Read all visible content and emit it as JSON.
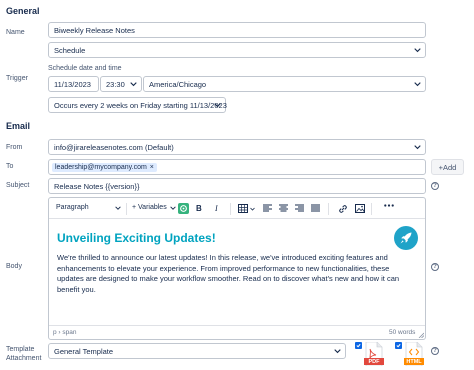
{
  "sections": {
    "general": "General",
    "email": "Email"
  },
  "labels": {
    "name": "Name",
    "trigger": "Trigger",
    "schedule_date_time": "Schedule date and time",
    "from": "From",
    "to": "To",
    "subject": "Subject",
    "body": "Body",
    "template_attachment": "Template Attachment"
  },
  "fields": {
    "name": "Biweekly Release Notes",
    "trigger_type": "Schedule",
    "date": "11/13/2023",
    "time": "23:30",
    "timezone": "America/Chicago",
    "recurrence": "Occurs every 2 weeks on Friday starting 11/13/2023",
    "from": "info@jirareleasenotes.com (Default)",
    "to_tag": "leadership@mycompany.com",
    "to_tag_remove": "×",
    "add_button": "+Add",
    "subject": "Release Notes {{version}}",
    "template": "General Template"
  },
  "toolbar": {
    "paragraph": "Paragraph",
    "variables": "+ Variables",
    "bold": "B",
    "italic": "I"
  },
  "editor": {
    "heading": "Unveiling Exciting Updates!",
    "paragraph": "We're thrilled to announce our latest updates! In this release, we've introduced exciting features and enhancements to elevate your experience. From improved performance to new functionalities, these updates are designed to make your workflow smoother. Read on to discover what's new and how it can benefit you.",
    "path": "p › span",
    "word_count": "50 words"
  },
  "attachments": {
    "pdf_label": "PDF",
    "html_label": "HTML"
  },
  "colors": {
    "accent": "#0c66e4",
    "heading": "#00a3bf",
    "pdf": "#e2483d",
    "html": "#ff8b00"
  }
}
